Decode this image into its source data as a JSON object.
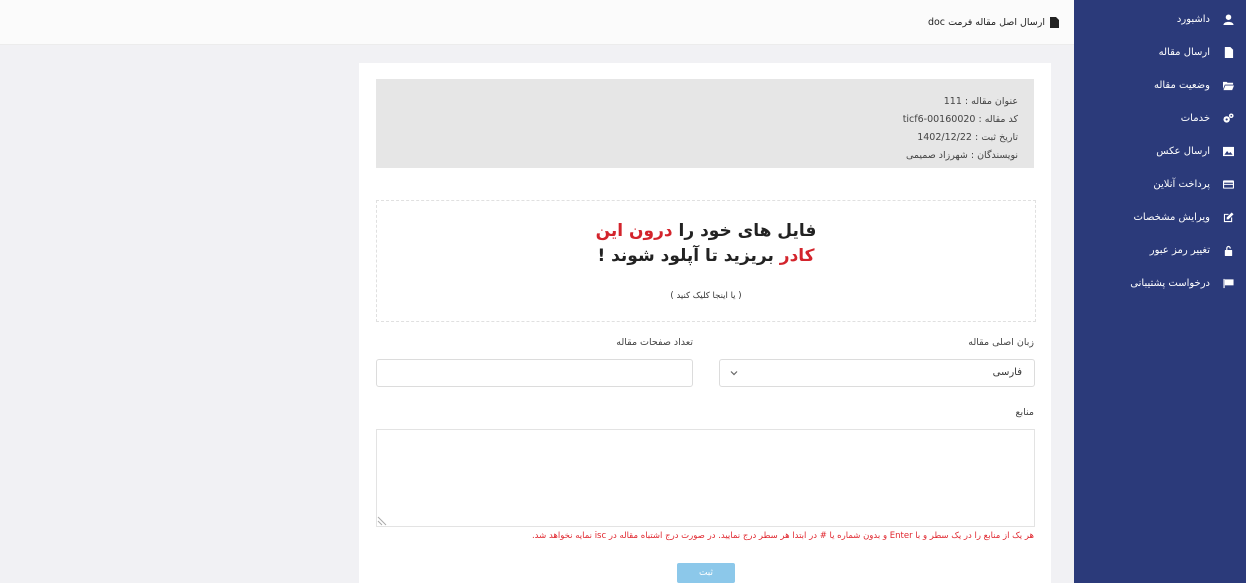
{
  "header": {
    "title": "ارسال اصل مقاله فرمت doc"
  },
  "sidebar": {
    "items": [
      {
        "label": "داشبورد",
        "icon": "user-icon"
      },
      {
        "label": "ارسال مقاله",
        "icon": "file-icon"
      },
      {
        "label": "وضعیت مقاله",
        "icon": "folder-open-icon"
      },
      {
        "label": "خدمات",
        "icon": "cogs-icon"
      },
      {
        "label": "ارسال عکس",
        "icon": "image-icon"
      },
      {
        "label": "پرداخت آنلاین",
        "icon": "credit-card-icon"
      },
      {
        "label": "ویرایش مشخصات",
        "icon": "edit-icon"
      },
      {
        "label": "تغییر رمز عبور",
        "icon": "lock-icon"
      },
      {
        "label": "درخواست پشتیبانی",
        "icon": "flag-icon"
      }
    ]
  },
  "article_info": {
    "title_line": "عنوان مقاله : 111",
    "code_line": "کد مقاله : ticf6-00160020",
    "date_line": "تاریخ ثبت : 1402/12/22",
    "authors_line": "نویسندگان : شهرزاد صمیمی"
  },
  "dropzone": {
    "line1_a": "فایل های خود را ",
    "line1_b": "درون این",
    "line2_a": "کادر",
    "line2_b": " بریزید تا آپلود شوند !",
    "hint": "( یا اینجا کلیک کنید )"
  },
  "form": {
    "language_label": "زبان اصلی مقاله",
    "language_value": "فارسی",
    "pages_label": "تعداد صفحات مقاله",
    "pages_value": "",
    "sources_label": "منابع",
    "sources_value": "",
    "warning": "هر یک از منابع را در یک سطر و با Enter و بدون شماره یا # در ابتدا هر سطر درج نمایید. در صورت درج اشتباه مقاله در isc نمایه نخواهد شد.",
    "submit_label": "ثبت"
  },
  "colors": {
    "sidebar": "#2b3a7a",
    "accent_red": "#d3242c",
    "button": "#8cc8ea"
  }
}
